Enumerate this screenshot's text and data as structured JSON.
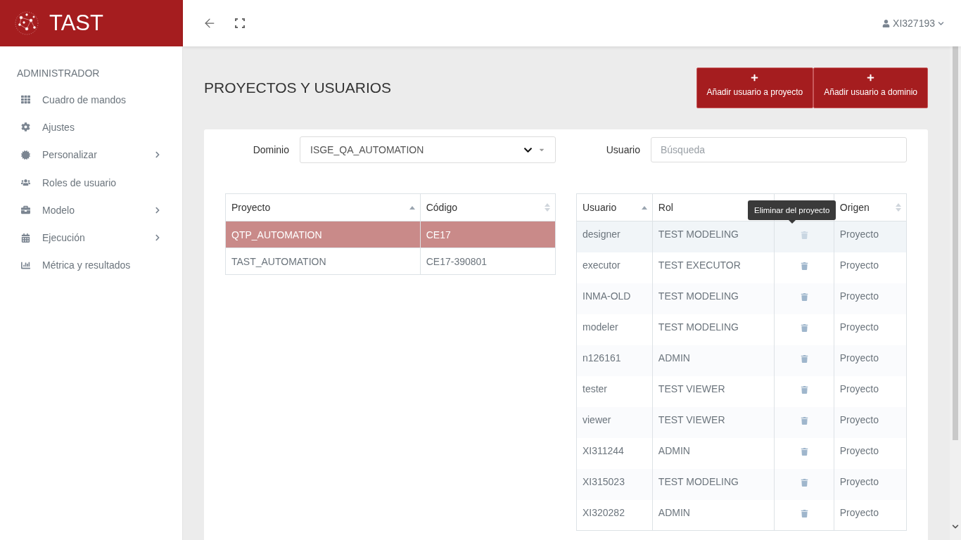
{
  "app": {
    "title": "TAST"
  },
  "user": {
    "name": "XI327193"
  },
  "sidebar": {
    "heading": "ADMINISTRADOR",
    "items": [
      {
        "label": "Cuadro de mandos",
        "kind": "dashboard",
        "expandable": false
      },
      {
        "label": "Ajustes",
        "kind": "settings",
        "expandable": false
      },
      {
        "label": "Personalizar",
        "kind": "badge",
        "expandable": true
      },
      {
        "label": "Roles de usuario",
        "kind": "users",
        "expandable": false
      },
      {
        "label": "Modelo",
        "kind": "briefcase",
        "expandable": true
      },
      {
        "label": "Ejecución",
        "kind": "calendar",
        "expandable": true
      },
      {
        "label": "Métrica y resultados",
        "kind": "chart",
        "expandable": false
      }
    ]
  },
  "page_title": "PROYECTOS Y USUARIOS",
  "buttons": [
    {
      "label": "Añadir usuario a proyecto"
    },
    {
      "label": "Añadir usuario a dominio"
    }
  ],
  "domain": {
    "label": "Dominio",
    "value": "ISGE_QA_AUTOMATION"
  },
  "user_search": {
    "label": "Usuario",
    "placeholder": "Búsqueda"
  },
  "projects": {
    "columns": [
      {
        "label": "Proyecto",
        "sorted": true
      },
      {
        "label": "Código",
        "sorted": false
      }
    ],
    "rows": [
      {
        "cells": [
          "QTP_AUTOMATION",
          "CE17"
        ],
        "selected": true
      },
      {
        "cells": [
          "TAST_AUTOMATION",
          "CE17-390801"
        ],
        "selected": false
      }
    ]
  },
  "users": {
    "columns": [
      {
        "label": "Usuario",
        "sorted": true
      },
      {
        "label": "Rol"
      },
      {},
      {
        "label": "Origen",
        "sorted": false
      }
    ],
    "rows": [
      {
        "cells": [
          "designer",
          "TEST MODELING",
          "Proyecto"
        ],
        "hovered": true
      },
      {
        "cells": [
          "executor",
          "TEST EXECUTOR",
          "Proyecto"
        ],
        "hovered": false
      },
      {
        "cells": [
          "INMA-OLD",
          "TEST MODELING",
          "Proyecto"
        ],
        "hovered": false
      },
      {
        "cells": [
          "modeler",
          "TEST MODELING",
          "Proyecto"
        ],
        "hovered": false
      },
      {
        "cells": [
          "n126161",
          "ADMIN",
          "Proyecto"
        ],
        "hovered": false
      },
      {
        "cells": [
          "tester",
          "TEST VIEWER",
          "Proyecto"
        ],
        "hovered": false
      },
      {
        "cells": [
          "viewer",
          "TEST VIEWER",
          "Proyecto"
        ],
        "hovered": false
      },
      {
        "cells": [
          "XI311244",
          "ADMIN",
          "Proyecto"
        ],
        "hovered": false
      },
      {
        "cells": [
          "XI315023",
          "TEST MODELING",
          "Proyecto"
        ],
        "hovered": false
      },
      {
        "cells": [
          "XI320282",
          "ADMIN",
          "Proyecto"
        ],
        "hovered": false
      }
    ]
  },
  "tooltip": {
    "text": "Eliminar del proyecto"
  }
}
